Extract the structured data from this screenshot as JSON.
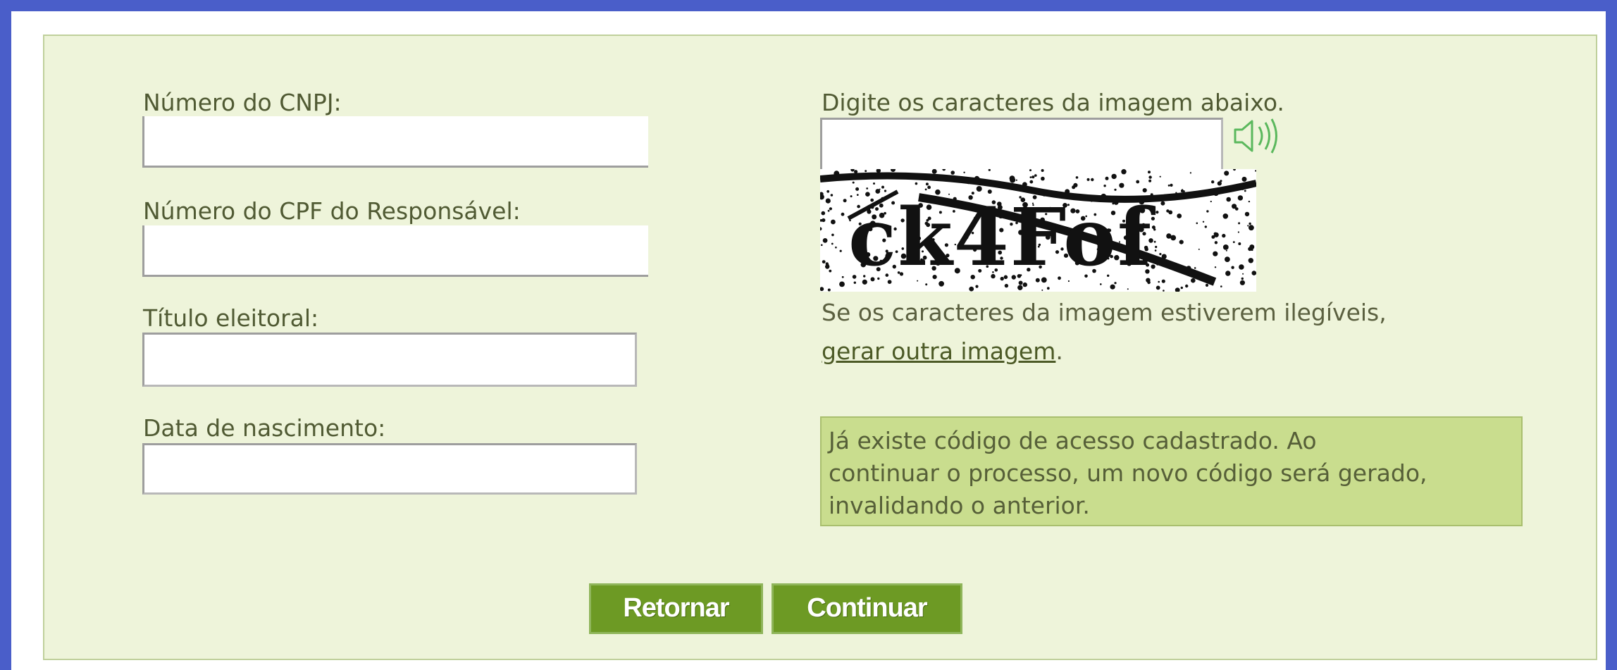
{
  "form": {
    "cnpj_label": "Número do CNPJ:",
    "cnpj_value": "",
    "cpf_label": "Número do CPF do Responsável:",
    "cpf_value": "",
    "titulo_label": "Título eleitoral:",
    "titulo_value": "",
    "nascimento_label": "Data de nascimento:",
    "nascimento_value": ""
  },
  "captcha": {
    "instruction": "Digite os caracteres da imagem abaixo.",
    "input_value": "",
    "image_text": "ck4Fof",
    "audio_icon": "speaker-icon",
    "illegible_text": "Se os caracteres da imagem estiverem ilegíveis,",
    "regen_link": "gerar outra imagem",
    "regen_suffix": "."
  },
  "notice": {
    "line1": "Já existe código de acesso cadastrado. Ao",
    "line2": "continuar o processo, um novo código será gerado,",
    "line3": "invalidando o anterior."
  },
  "buttons": {
    "back_label": "Retornar",
    "continue_label": "Continuar"
  },
  "colors": {
    "frame": "#4a5ec9",
    "panel_background": "#eef4da",
    "button": "#6d9a24",
    "notice_background": "#c9dd8e",
    "audio_icon": "#5bb85d"
  }
}
